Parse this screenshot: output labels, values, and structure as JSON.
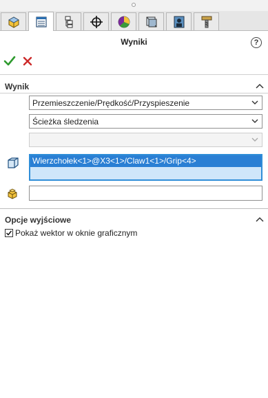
{
  "panel": {
    "title": "Wyniki",
    "help_glyph": "?",
    "ok_icon": "check-icon",
    "cancel_icon": "close-icon"
  },
  "tabs": [
    {
      "icon": "feature-manager-icon"
    },
    {
      "icon": "property-manager-icon"
    },
    {
      "icon": "configuration-manager-icon"
    },
    {
      "icon": "dimxpert-icon"
    },
    {
      "icon": "display-manager-icon"
    },
    {
      "icon": "cam-icon"
    },
    {
      "icon": "motion-study-icon"
    },
    {
      "icon": "tool-icon"
    }
  ],
  "wynik": {
    "title": "Wynik",
    "category": "Przemieszczenie/Prędkość/Przyspieszenie",
    "subcategory": "Ścieżka śledzenia",
    "component": ""
  },
  "selection": {
    "items": [
      "Wierzchołek<1>@X3<1>/Claw1<1>/Grip<4>"
    ],
    "reference_value": ""
  },
  "output": {
    "title": "Opcje wyjściowe",
    "show_vector_label": "Pokaż wektor w oknie graficznym",
    "show_vector_checked": true
  },
  "colors": {
    "accent": "#2a7fd4",
    "ok": "#2e9a2e",
    "cancel": "#cc2a2a"
  }
}
